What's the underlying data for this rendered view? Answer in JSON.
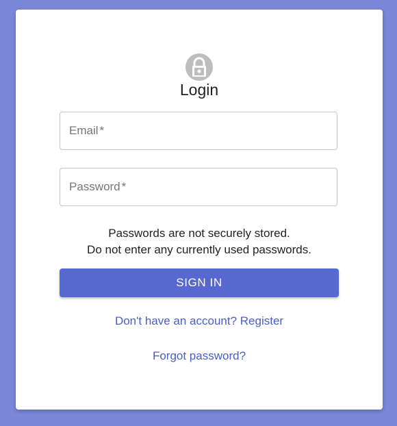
{
  "page": {
    "background_color": "#7b87d8",
    "accent_color": "#5769d0"
  },
  "login": {
    "icon": "lock-icon",
    "title": "Login",
    "email_label": "Email",
    "password_label": "Password",
    "required_marker": "*",
    "notice_line1": "Passwords are not securely stored.",
    "notice_line2": "Do not enter any currently used passwords.",
    "signin_label": "SIGN IN",
    "register_link": "Don't have an account? Register",
    "forgot_link": "Forgot password?"
  }
}
